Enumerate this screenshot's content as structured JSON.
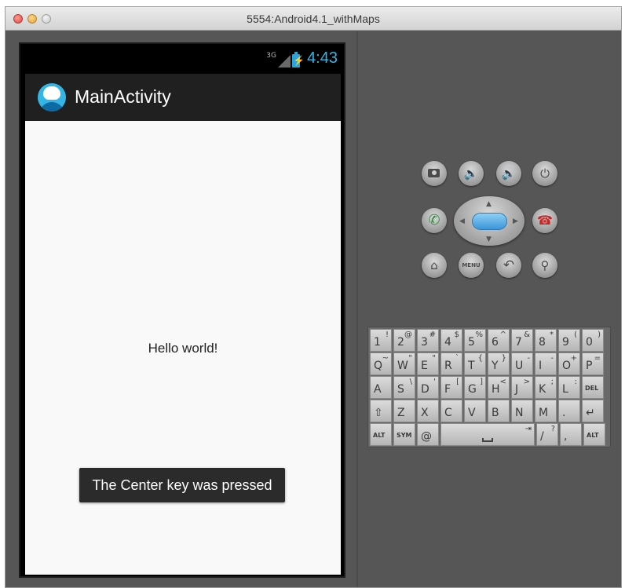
{
  "window": {
    "title": "5554:Android4.1_withMaps"
  },
  "device": {
    "status_bar": {
      "network": "3G",
      "time": "4:43",
      "battery_glyph": "⚡"
    },
    "action_bar": {
      "title": "MainActivity",
      "icon": "android-app-icon"
    },
    "content": {
      "text": "Hello world!"
    },
    "toast": {
      "text": "The Center key was pressed"
    }
  },
  "hardware_buttons": {
    "camera": "camera-icon",
    "volume_down": "🔉",
    "volume_up": "🔊",
    "power": "⏻",
    "call": "✆",
    "end_call": "☎",
    "home": "⌂",
    "menu": "MENU",
    "back": "↶",
    "search": "⚲",
    "dpad": {
      "up": "▲",
      "down": "▼",
      "left": "◀",
      "right": "▶"
    }
  },
  "keyboard": {
    "rows": [
      [
        [
          "1",
          "!"
        ],
        [
          "2",
          "@"
        ],
        [
          "3",
          "#"
        ],
        [
          "4",
          "$"
        ],
        [
          "5",
          "%"
        ],
        [
          "6",
          "^"
        ],
        [
          "7",
          "&"
        ],
        [
          "8",
          "*"
        ],
        [
          "9",
          "("
        ],
        [
          "0",
          ")"
        ]
      ],
      [
        [
          "Q",
          "~"
        ],
        [
          "W",
          "\""
        ],
        [
          "E",
          "\""
        ],
        [
          "R",
          "`"
        ],
        [
          "T",
          "{"
        ],
        [
          "Y",
          "}"
        ],
        [
          "U",
          "-"
        ],
        [
          "I",
          "-"
        ],
        [
          "O",
          "+"
        ],
        [
          "P",
          "="
        ]
      ],
      [
        [
          "A",
          ""
        ],
        [
          "S",
          "\\"
        ],
        [
          "D",
          "'"
        ],
        [
          "F",
          "["
        ],
        [
          "G",
          "]"
        ],
        [
          "H",
          "<"
        ],
        [
          "J",
          ">"
        ],
        [
          "K",
          ";"
        ],
        [
          "L",
          ":"
        ],
        [
          "DEL",
          ""
        ]
      ],
      [
        [
          "⇧",
          ""
        ],
        [
          "Z",
          ""
        ],
        [
          "X",
          ""
        ],
        [
          "C",
          ""
        ],
        [
          "V",
          ""
        ],
        [
          "B",
          ""
        ],
        [
          "N",
          ""
        ],
        [
          "M",
          ""
        ],
        [
          ".",
          ""
        ],
        [
          "↵",
          ""
        ]
      ]
    ],
    "bottom_row": {
      "alt_left": "ALT",
      "sym": "SYM",
      "at": "@",
      "space_alt": "⇥",
      "slash": "/",
      "slash_alt": "?",
      "comma": ",",
      "alt_right": "ALT"
    }
  }
}
